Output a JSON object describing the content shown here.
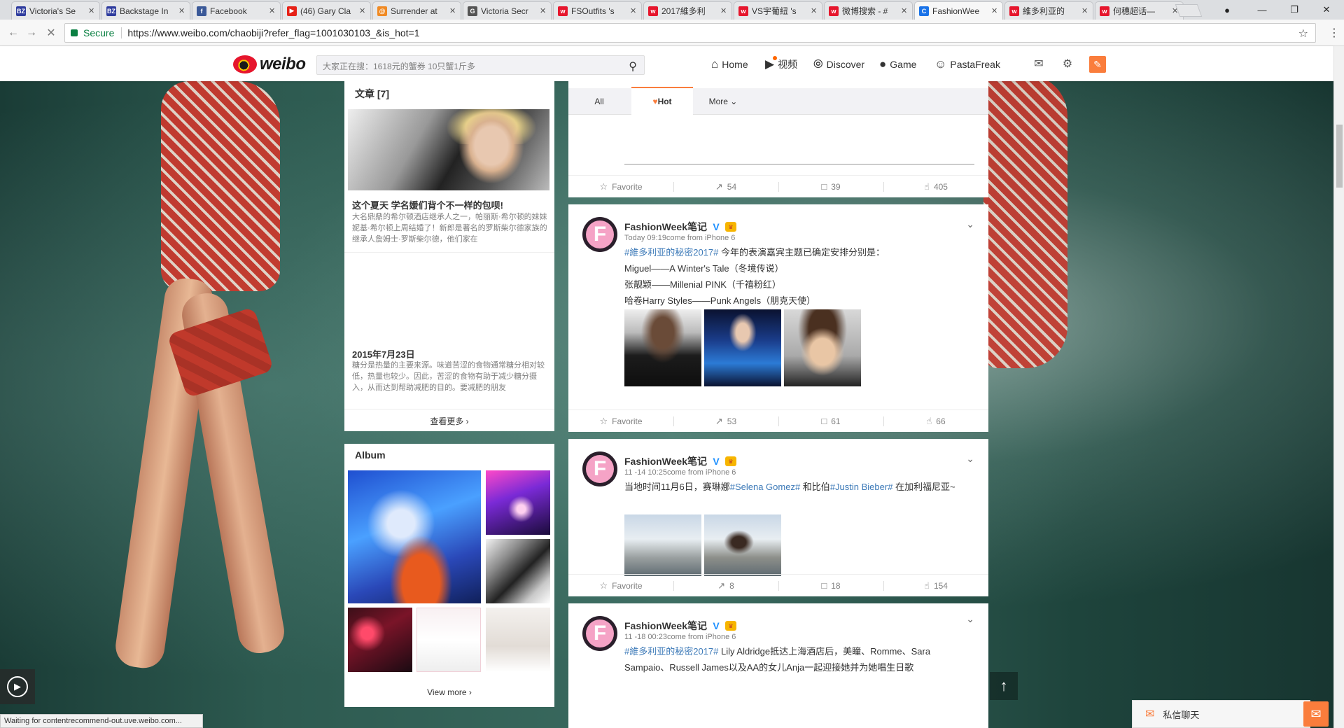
{
  "browser": {
    "tabs": [
      {
        "label": "Victoria's Se",
        "favicon": "BZ",
        "color": "#2f3c9e",
        "active": false
      },
      {
        "label": "Backstage In",
        "favicon": "BZ",
        "color": "#2f3c9e",
        "active": false
      },
      {
        "label": "Facebook",
        "favicon": "f",
        "color": "#3b5998",
        "active": false
      },
      {
        "label": "(46) Gary Cla",
        "favicon": "▶",
        "color": "#e62117",
        "active": false
      },
      {
        "label": "Surrender at",
        "favicon": "@",
        "color": "#f08a24",
        "active": false
      },
      {
        "label": "Victoria Secr",
        "favicon": "G",
        "color": "#555555",
        "active": false
      },
      {
        "label": "FSOutfits 's",
        "favicon": "w",
        "color": "#e6162d",
        "active": false
      },
      {
        "label": "2017維多利",
        "favicon": "w",
        "color": "#e6162d",
        "active": false
      },
      {
        "label": "VS宇葡紐 's",
        "favicon": "w",
        "color": "#e6162d",
        "active": false
      },
      {
        "label": "微博搜索 - #",
        "favicon": "w",
        "color": "#e6162d",
        "active": false
      },
      {
        "label": "FashionWee",
        "favicon": "C",
        "color": "#1a73e8",
        "active": true
      },
      {
        "label": "維多利亚的",
        "favicon": "w",
        "color": "#e6162d",
        "active": false
      },
      {
        "label": "何穗超话—",
        "favicon": "w",
        "color": "#e6162d",
        "active": false
      }
    ],
    "secure_label": "Secure",
    "url": "https://www.weibo.com/chaobiji?refer_flag=1001030103_&is_hot=1",
    "status": "Waiting for contentrecommend-out.uve.weibo.com..."
  },
  "nav": {
    "logo_text": "weibo",
    "search_placeholder": "大家正在搜：1618元的蟹券 10只蟹1斤多",
    "items": [
      {
        "label": "Home",
        "icon": "home-icon"
      },
      {
        "label": "视频",
        "icon": "video-icon"
      },
      {
        "label": "Discover",
        "icon": "discover-icon"
      },
      {
        "label": "Game",
        "icon": "game-icon"
      },
      {
        "label": "PastaFreak",
        "icon": "user-icon"
      }
    ]
  },
  "articles": {
    "title": "文章 [7]",
    "items": [
      {
        "headline": "这个夏天 学名媛们背个不一样的包呗!",
        "body": "大名鼎鼎的希尔顿酒店继承人之一，帕丽斯·希尔顿的妹妹妮基·希尔顿上周结婚了！新郎是著名的罗斯柴尔德家族的继承人詹姆士·罗斯柴尔德，他们家在"
      },
      {
        "headline": "2015年7月23日",
        "body": "糖分是热量的主要来源。味道苦涩的食物通常糖分相对较低，热量也较少。因此，苦涩的食物有助于减少糖分摄入，从而达到帮助减肥的目的。要减肥的朋友"
      }
    ],
    "more": "查看更多"
  },
  "album": {
    "title": "Album",
    "more": "View more"
  },
  "feed": {
    "tabs": {
      "all": "All",
      "hot": "Hot",
      "more": "More"
    },
    "first_actions": {
      "favorite": "Favorite",
      "repost": "54",
      "comment": "39",
      "like": "405"
    },
    "posts": [
      {
        "name": "FashionWeek笔记",
        "meta": "Today 09:19come from iPhone 6",
        "topic": "#維多利亚的秘密2017#",
        "line1": " 今年的表演嘉宾主题已确定安排分别是：",
        "line2": "Miguel——A Winter's Tale（冬境传说）",
        "line3": "张靓颖——Millenial PINK（千禧粉红）",
        "line4": "哈卷Harry Styles——Punk Angels（朋克天使）",
        "actions": {
          "favorite": "Favorite",
          "repost": "53",
          "comment": "61",
          "like": "66"
        }
      },
      {
        "name": "FashionWeek笔记",
        "meta": "11 -14 10:25come from iPhone 6",
        "pre": "当地时间11月6日，赛琳娜",
        "topic1": "#Selena Gomez#",
        "mid": " 和比伯",
        "topic2": "#Justin Bieber#",
        "post": " 在加利福尼亚~",
        "actions": {
          "favorite": "Favorite",
          "repost": "8",
          "comment": "18",
          "like": "154"
        }
      },
      {
        "name": "FashionWeek笔记",
        "meta": "11 -18 00:23come from iPhone 6",
        "topic": "#維多利亚的秘密2017#",
        "line1": " Lily Aldridge抵达上海酒店后，美瞳、Romme、Sara",
        "line2": "Sampaio、Russell James以及AA的女儿Anja一起迎接她并为她唱生日歌"
      }
    ]
  },
  "chat": {
    "label": "私信聊天"
  }
}
